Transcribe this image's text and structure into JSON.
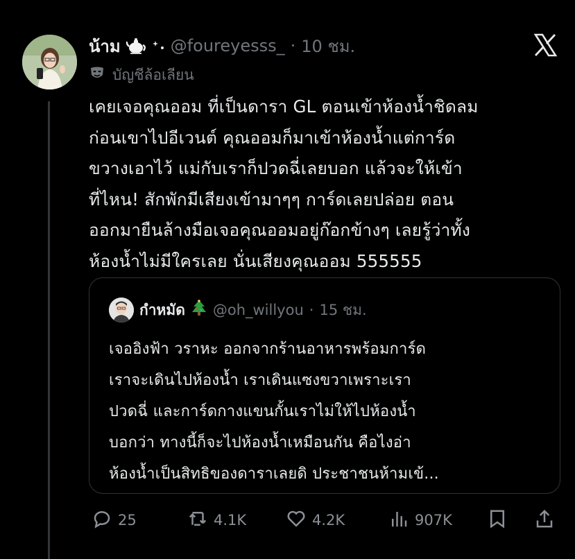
{
  "tweet": {
    "display_name": "น้าม",
    "handle": "@foureyesss_",
    "separator": "·",
    "time": "10 ชม.",
    "parody_label": "บัญชีล้อเลียน",
    "text": "เคยเจอคุณออม ที่เป็นดารา GL ตอนเข้าห้องน้ำชิดลม\nก่อนเขาไปอีเวนต์ คุณออมก็มาเข้าห้องน้ำแต่การ์ด\nขวางเอาไว้ แม่กับเราก็ปวดฉี่เลยบอก แล้วจะให้เข้า\nที่ไหน! สักพักมีเสียงเข้ามาๆๆ การ์ดเลยปล่อย ตอน\nออกมายืนล้างมือเจอคุณออมอยู่ก๊อกข้างๆ เลยรู้ว่าทั้ง\nห้องน้ำไม่มีใครเลย นั่นเสียงคุณออม 555555"
  },
  "quoted": {
    "display_name": "กำหมัด",
    "handle": "@oh_willyou",
    "separator": "·",
    "time": "15 ชม.",
    "text": "เจออิงฟ้า วราหะ ออกจากร้านอาหารพร้อมการ์ด\nเราจะเดินไปห้องน้ำ เราเดินแซงขวาเพราะเรา\nปวดฉี่ และการ์ดกางแขนกั้นเราไม่ให้ไปห้องน้ำ\nบอกว่า ทางนี้ก็จะไปห้องน้ำเหมือนกัน คือไงอ่า\nห้องน้ำเป็นสิทธิของดาราเลยดิ ประชาชนห้ามเข้..."
  },
  "actions": {
    "replies": "25",
    "reposts": "4.1K",
    "likes": "4.2K",
    "views": "907K"
  },
  "colors": {
    "background": "#000000",
    "text": "#e7e9ea",
    "muted": "#71767b",
    "border": "#2f3336"
  }
}
